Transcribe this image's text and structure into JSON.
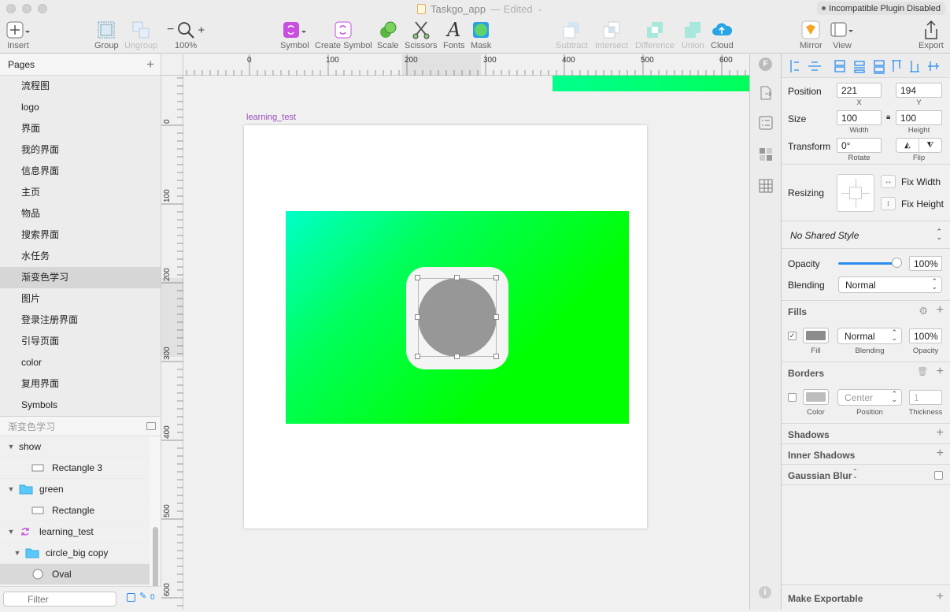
{
  "window": {
    "title": "Taskgo_app",
    "status": "— Edited",
    "plugin_badge": "Incompatible Plugin Disabled"
  },
  "toolbar": {
    "insert": "Insert",
    "group": "Group",
    "ungroup": "Ungroup",
    "zoom": "100%",
    "symbol": "Symbol",
    "create_symbol": "Create Symbol",
    "scale": "Scale",
    "scissors": "Scissors",
    "fonts": "Fonts",
    "mask": "Mask",
    "subtract": "Subtract",
    "intersect": "Intersect",
    "difference": "Difference",
    "union": "Union",
    "cloud": "Cloud",
    "mirror": "Mirror",
    "view": "View",
    "export": "Export"
  },
  "pages": {
    "header": "Pages",
    "items": [
      "流程图",
      "logo",
      "界面",
      "我的界面",
      "信息界面",
      "主页",
      "物品",
      "搜索界面",
      "水任务",
      "渐变色学习",
      "图片",
      "登录注册界面",
      "引导页面",
      "color",
      "复用界面",
      "Symbols"
    ],
    "selected_index": 9
  },
  "layers": {
    "header": "渐变色学习",
    "items": [
      {
        "label": "show",
        "kind": "group",
        "indent": 0,
        "expanded": true
      },
      {
        "label": "Rectangle 3",
        "kind": "rect",
        "indent": 2,
        "expanded": false
      },
      {
        "label": "green",
        "kind": "folder",
        "indent": 0,
        "expanded": true
      },
      {
        "label": "Rectangle",
        "kind": "rect",
        "indent": 2,
        "expanded": false
      },
      {
        "label": "learning_test",
        "kind": "symbol",
        "indent": 0,
        "expanded": true
      },
      {
        "label": "circle_big copy",
        "kind": "folder",
        "indent": 1,
        "expanded": true
      },
      {
        "label": "Oval",
        "kind": "oval",
        "indent": 2,
        "expanded": false
      }
    ],
    "selected_index": 6,
    "filter_placeholder": "Filter",
    "filter_count": "0"
  },
  "rulers": {
    "top_ticks": [
      "0",
      "100",
      "200",
      "300",
      "400",
      "500",
      "600"
    ],
    "left_ticks": [
      "0",
      "100",
      "200",
      "300",
      "400",
      "500",
      "600"
    ]
  },
  "canvas": {
    "artboard_label": "learning_test"
  },
  "inspector": {
    "position": {
      "label": "Position",
      "x": "221",
      "y": "194",
      "x_sub": "X",
      "y_sub": "Y"
    },
    "size": {
      "label": "Size",
      "width": "100",
      "height": "100",
      "w_sub": "Width",
      "h_sub": "Height"
    },
    "transform": {
      "label": "Transform",
      "rotate": "0°",
      "rotate_sub": "Rotate",
      "flip_sub": "Flip"
    },
    "resizing": {
      "label": "Resizing",
      "fix_width": "Fix Width",
      "fix_height": "Fix Height"
    },
    "shared_style": "No Shared Style",
    "opacity": {
      "label": "Opacity",
      "value": "100%",
      "level": 1.0
    },
    "blending": {
      "label": "Blending",
      "value": "Normal"
    },
    "fills": {
      "header": "Fills",
      "blending": "Normal",
      "opacity": "100%",
      "fill_sub": "Fill",
      "blending_sub": "Blending",
      "opacity_sub": "Opacity",
      "color": "#8c8c8c",
      "enabled": true
    },
    "borders": {
      "header": "Borders",
      "position": "Center",
      "thickness": "1",
      "color_sub": "Color",
      "position_sub": "Position",
      "thickness_sub": "Thickness",
      "color": "#bdbdbd",
      "enabled": false
    },
    "shadows": "Shadows",
    "inner_shadows": "Inner Shadows",
    "gaussian_blur": "Gaussian Blur",
    "make_exportable": "Make Exportable"
  },
  "colors": {
    "accent": "#2a8cf0",
    "gradient_start": "#00ffc8",
    "gradient_end": "#00ff00",
    "oval": "#979797",
    "artboard_label": "#9b4fb8"
  }
}
